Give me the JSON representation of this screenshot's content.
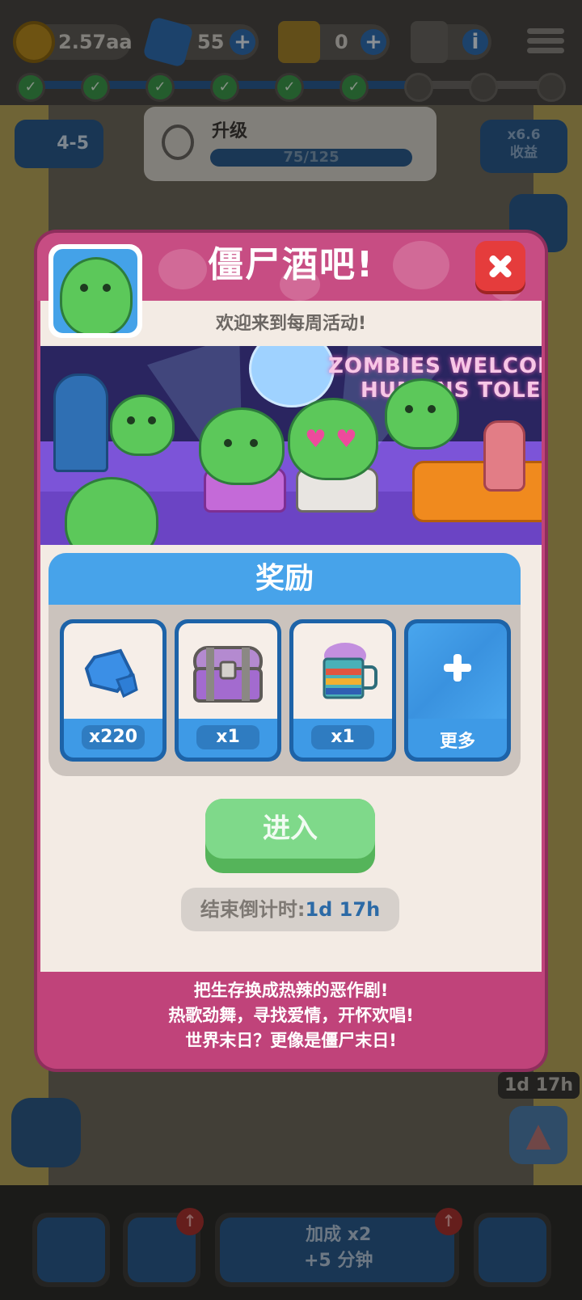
{
  "hud": {
    "coins": "2.57aa",
    "gems": "55",
    "tickets": "0",
    "level": "4-5",
    "upgrade_label": "升级",
    "upgrade_progress": "75/125",
    "earnings_multiplier": "x6.6",
    "earnings_label": "收益",
    "event_timer": "1d 17h"
  },
  "bottom_bar": {
    "boost_line1": "加成 x2",
    "boost_line2": "+5 分钟"
  },
  "modal": {
    "title": "僵尸酒吧!",
    "subtitle": "欢迎来到每周活动!",
    "banner_sign_line1": "ZOMBIES WELCOME",
    "banner_sign_line2": "HUMANS TOLERA",
    "rewards_title": "奖励",
    "rewards": [
      {
        "icon": "gem-icon",
        "label": "x220"
      },
      {
        "icon": "treasure-chest-icon",
        "label": "x1"
      },
      {
        "icon": "beer-mug-icon",
        "label": "x1"
      },
      {
        "icon": "plus-icon",
        "label": "更多"
      }
    ],
    "enter_label": "进入",
    "countdown_label": "结束倒计时:",
    "countdown_value": "1d 17h",
    "description": [
      "把生存换成热辣的恶作剧!",
      "热歌劲舞，寻找爱情，开怀欢唱!",
      "世界末日？更像是僵尸末日!"
    ]
  },
  "colors": {
    "modal_frame": "#c0437a",
    "rewards_header": "#47a3ea",
    "enter_button": "#7fd98a",
    "close_button": "#e53c3c",
    "countdown_value": "#2c6aa6"
  }
}
